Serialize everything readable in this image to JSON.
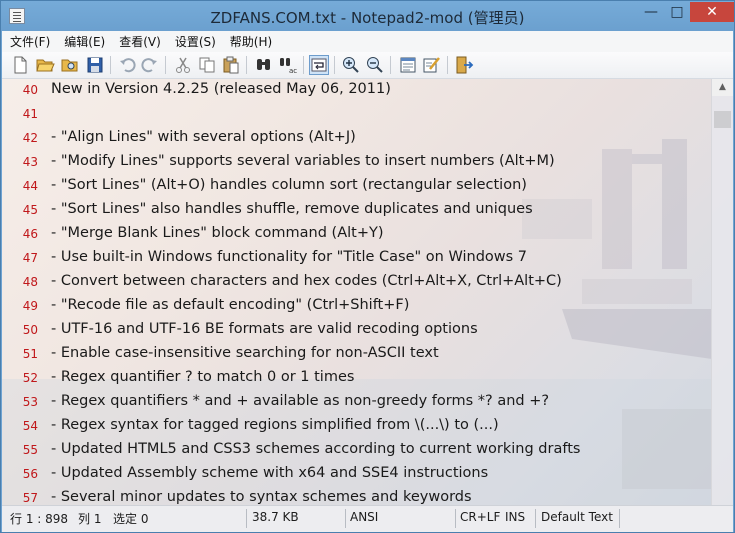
{
  "window": {
    "title": "ZDFANS.COM.txt - Notepad2-mod (管理员)",
    "minimize": "—",
    "maximize": "□",
    "close": "✕"
  },
  "menu": {
    "items": [
      "文件(F)",
      "编辑(E)",
      "查看(V)",
      "设置(S)",
      "帮助(H)"
    ]
  },
  "toolbar": {
    "buttons": [
      "new-file-icon",
      "open-file-icon",
      "browse-icon",
      "save-icon",
      "undo-icon",
      "redo-icon",
      "cut-icon",
      "copy-icon",
      "paste-icon",
      "find-icon",
      "replace-icon",
      "word-wrap-icon",
      "zoom-in-icon",
      "zoom-out-icon",
      "scheme-icon",
      "customize-scheme-icon",
      "exit-icon"
    ]
  },
  "editor": {
    "lines": [
      {
        "num": "40",
        "text": "New in Version 4.2.25 (released May 06, 2011)"
      },
      {
        "num": "41",
        "text": ""
      },
      {
        "num": "42",
        "text": " - \"Align Lines\" with several options (Alt+J)"
      },
      {
        "num": "43",
        "text": " - \"Modify Lines\" supports several variables to insert numbers (Alt+M)"
      },
      {
        "num": "44",
        "text": " - \"Sort Lines\" (Alt+O) handles column sort (rectangular selection)"
      },
      {
        "num": "45",
        "text": " - \"Sort Lines\" also handles shuffle, remove duplicates and uniques"
      },
      {
        "num": "46",
        "text": " - \"Merge Blank Lines\" block command (Alt+Y)"
      },
      {
        "num": "47",
        "text": " - Use built-in Windows functionality for \"Title Case\" on Windows 7"
      },
      {
        "num": "48",
        "text": " - Convert between characters and hex codes (Ctrl+Alt+X, Ctrl+Alt+C)"
      },
      {
        "num": "49",
        "text": " - \"Recode file as default encoding\" (Ctrl+Shift+F)"
      },
      {
        "num": "50",
        "text": " - UTF-16 and UTF-16 BE formats are valid recoding options"
      },
      {
        "num": "51",
        "text": " - Enable case-insensitive searching for non-ASCII text"
      },
      {
        "num": "52",
        "text": " - Regex quantifier ? to match 0 or 1 times"
      },
      {
        "num": "53",
        "text": " - Regex quantifiers * and + available as non-greedy forms *? and +?"
      },
      {
        "num": "54",
        "text": " - Regex syntax for tagged regions simplified from \\(...\\) to (...)"
      },
      {
        "num": "55",
        "text": " - Updated HTML5 and CSS3 schemes according to current working drafts"
      },
      {
        "num": "56",
        "text": " - Updated Assembly scheme with x64 and SSE4 instructions"
      },
      {
        "num": "57",
        "text": " - Several minor updates to syntax schemes and keywords"
      }
    ]
  },
  "statusbar": {
    "position": "行 1 : 898",
    "column": "列 1",
    "selection": "选定 0",
    "size": "38.7 KB",
    "encoding": "ANSI",
    "eol": "CR+LF",
    "mode": "INS",
    "scheme": "Default Text"
  },
  "colors": {
    "titlebar": "#6fa3d2",
    "line_number": "#c0181b",
    "close_button": "#c7463d"
  }
}
